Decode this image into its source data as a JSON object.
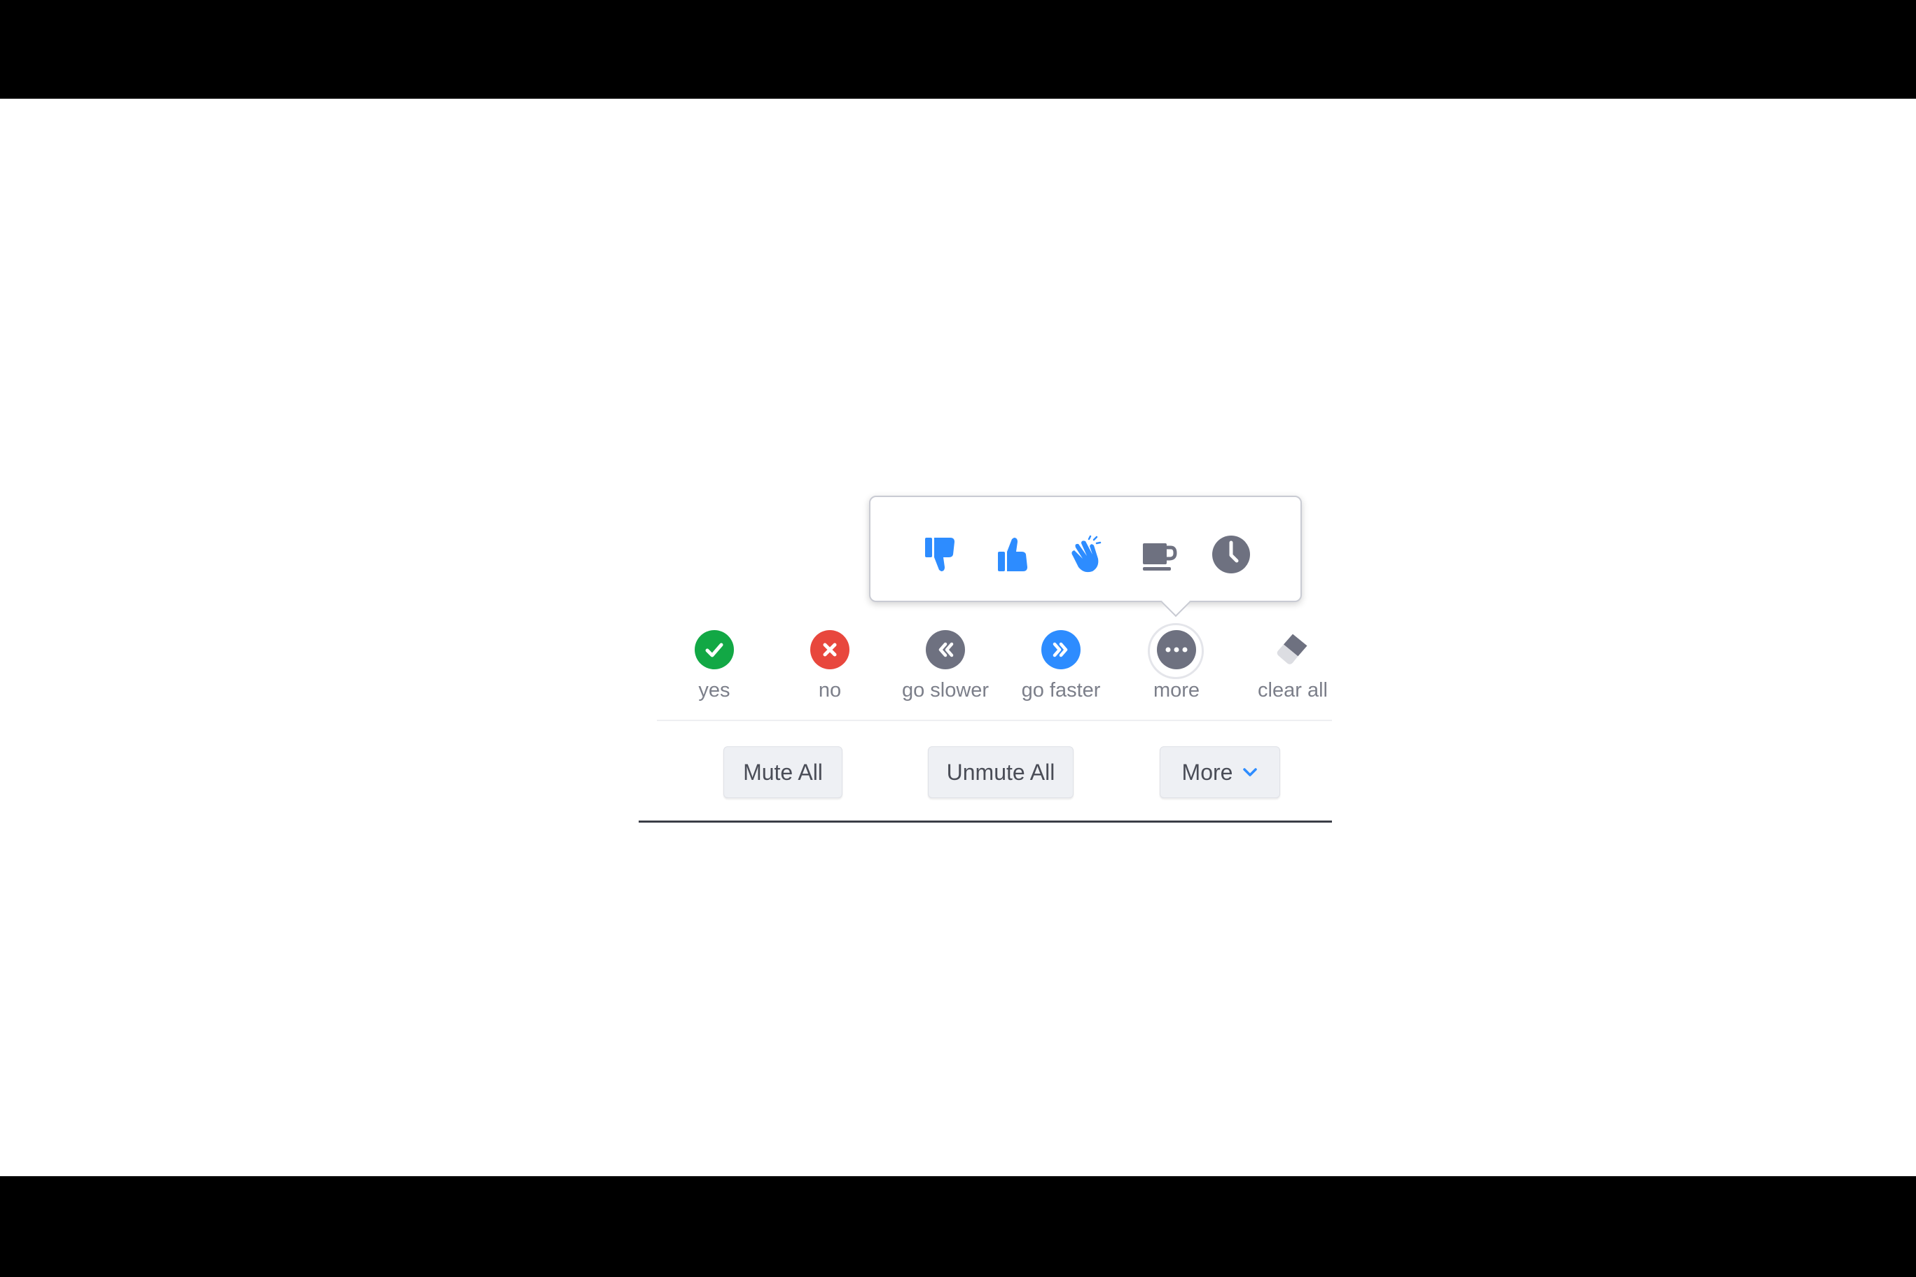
{
  "popover": {
    "items": [
      {
        "icon": "thumbs-down-icon",
        "color": "#2d8cff"
      },
      {
        "icon": "thumbs-up-icon",
        "color": "#2d8cff"
      },
      {
        "icon": "clap-icon",
        "color": "#2d8cff"
      },
      {
        "icon": "coffee-icon",
        "color": "#6e7180"
      },
      {
        "icon": "clock-icon",
        "color": "#6e7180"
      }
    ]
  },
  "reactions": [
    {
      "label": "yes",
      "icon": "check-icon",
      "color": "#12a845"
    },
    {
      "label": "no",
      "icon": "x-icon",
      "color": "#e8473d"
    },
    {
      "label": "go slower",
      "icon": "rewind-icon",
      "color": "#6e7180"
    },
    {
      "label": "go faster",
      "icon": "fast-forward-icon",
      "color": "#2d8cff"
    },
    {
      "label": "more",
      "icon": "ellipsis-icon",
      "color": "#6e7180"
    },
    {
      "label": "clear all",
      "icon": "eraser-icon",
      "color": "#6e7180"
    }
  ],
  "buttons": {
    "mute_all": "Mute All",
    "unmute_all": "Unmute All",
    "more": "More"
  }
}
